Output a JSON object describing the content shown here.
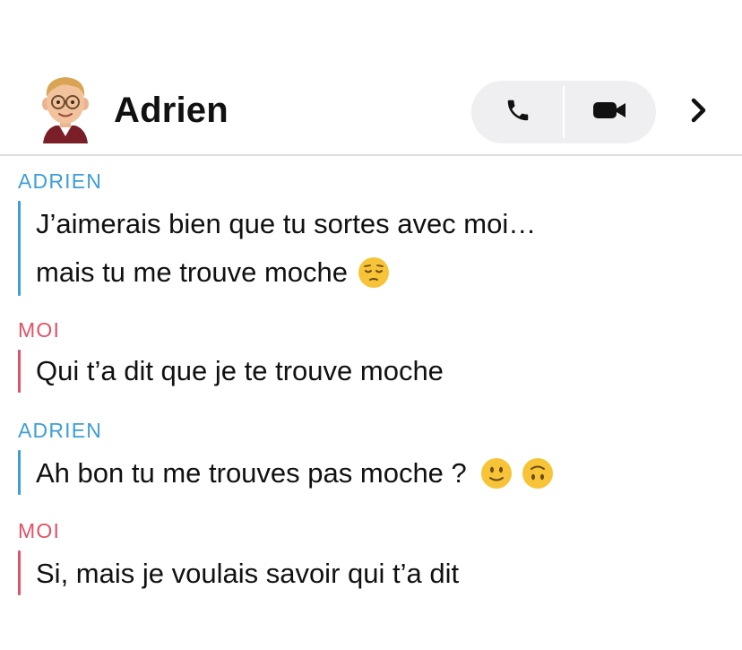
{
  "header": {
    "contact_name": "Adrien",
    "avatar_icon": "bitmoji-avatar-icon",
    "call_button_icon": "phone-icon",
    "video_button_icon": "video-camera-icon",
    "more_icon": "chevron-right-icon"
  },
  "messages": [
    {
      "sender": "ADRIEN",
      "from": "friend",
      "lines": [
        "J’aimerais bien que tu sortes avec moi…",
        "mais tu me trouve moche"
      ],
      "emojis": [
        "pensive-face"
      ]
    },
    {
      "sender": "MOI",
      "from": "me",
      "lines": [
        "Qui t’a dit que je te trouve moche"
      ],
      "emojis": []
    },
    {
      "sender": "ADRIEN",
      "from": "friend",
      "lines": [
        "Ah bon tu me trouves pas moche ?"
      ],
      "emojis": [
        "slightly-smiling-face",
        "upside-down-face"
      ]
    },
    {
      "sender": "MOI",
      "from": "me",
      "lines": [
        "Si, mais je voulais savoir qui t’a dit"
      ],
      "emojis": []
    }
  ],
  "colors": {
    "friend": "#3e9ed6",
    "me": "#e05266",
    "pill_bg": "#efeff1",
    "emoji_yellow": "#f7c437"
  }
}
